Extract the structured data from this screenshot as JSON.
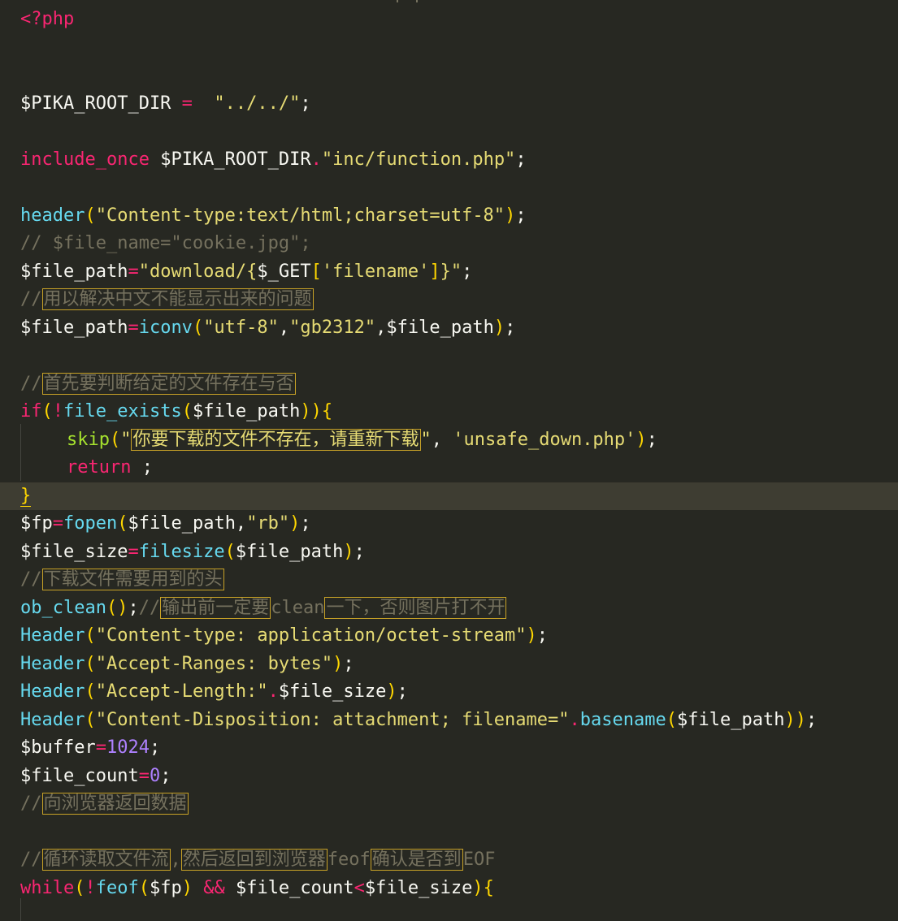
{
  "editor": {
    "lines": {
      "l01": {
        "t1": "<?php"
      },
      "l02": {
        "t1": "$PIKA_ROOT_DIR",
        "t2": " = ",
        "t3": " \"../../\"",
        "t4": ";"
      },
      "l03": {
        "t1": "include_once",
        "t2": " $PIKA_ROOT_DIR",
        "t3": ".",
        "t4": "\"inc/function.php\"",
        "t5": ";"
      },
      "l04": {
        "t1": "header",
        "t2": "(",
        "t3": "\"Content-type:text/html;charset=utf-8\"",
        "t4": ")",
        "t5": ";"
      },
      "l05": {
        "t1": "// $file_name=\"cookie.jpg\";"
      },
      "l06": {
        "t1": "$file_path",
        "t2": "=",
        "t3": "\"download/{",
        "t4": "$_GET",
        "t5": "[",
        "t6": "'filename'",
        "t7": "]",
        "t8": "}\"",
        "t9": ";"
      },
      "l07": {
        "t1": "//",
        "t2": "用以解决中文不能显示出来的问题"
      },
      "l08": {
        "t1": "$file_path",
        "t2": "=",
        "t3": "iconv",
        "t4": "(",
        "t5": "\"utf-8\"",
        "t6": ",",
        "t7": "\"gb2312\"",
        "t8": ",$file_path",
        "t9": ")",
        "t10": ";"
      },
      "l09": {
        "t1": "//",
        "t2": "首先要判断给定的文件存在与否"
      },
      "l10": {
        "t1": "if",
        "t2": "(",
        "t3": "!",
        "t4": "file_exists",
        "t5": "(",
        "t6": "$file_path",
        "t7": "))",
        "t8": "{"
      },
      "l11": {
        "t1": "skip",
        "t2": "(",
        "t3": "\"",
        "t4": "你要下载的文件不存在，请重新下载",
        "t5": "\"",
        "t6": ", ",
        "t7": "'unsafe_down.php'",
        "t8": ")",
        "t9": ";"
      },
      "l12": {
        "t1": "return",
        "t2": " ;"
      },
      "l13": {
        "t1": "}"
      },
      "l14": {
        "t1": "$fp",
        "t2": "=",
        "t3": "fopen",
        "t4": "(",
        "t5": "$file_path,",
        "t6": "\"rb\"",
        "t7": ")",
        "t8": ";"
      },
      "l15": {
        "t1": "$file_size",
        "t2": "=",
        "t3": "filesize",
        "t4": "(",
        "t5": "$file_path",
        "t6": ")",
        "t7": ";"
      },
      "l16": {
        "t1": "//",
        "t2": "下载文件需要用到的头"
      },
      "l17": {
        "t1": "ob_clean",
        "t2": "()",
        "t3": ";",
        "t4": "//",
        "t5": "输出前一定要",
        "t6": "clean",
        "t7": "一下，否则图片打不开"
      },
      "l18": {
        "t1": "Header",
        "t2": "(",
        "t3": "\"Content-type: application/octet-stream\"",
        "t4": ")",
        "t5": ";"
      },
      "l19": {
        "t1": "Header",
        "t2": "(",
        "t3": "\"Accept-Ranges: bytes\"",
        "t4": ")",
        "t5": ";"
      },
      "l20": {
        "t1": "Header",
        "t2": "(",
        "t3": "\"Accept-Length:\"",
        "t4": ".",
        "t5": "$file_size",
        "t6": ")",
        "t7": ";"
      },
      "l21": {
        "t1": "Header",
        "t2": "(",
        "t3": "\"Content-Disposition: attachment; filename=\"",
        "t4": ".",
        "t5": "basename",
        "t6": "(",
        "t7": "$file_path",
        "t8": "))",
        "t9": ";"
      },
      "l22": {
        "t1": "$buffer",
        "t2": "=",
        "t3": "1024",
        "t4": ";"
      },
      "l23": {
        "t1": "$file_count",
        "t2": "=",
        "t3": "0",
        "t4": ";"
      },
      "l24": {
        "t1": "//",
        "t2": "向浏览器返回数据"
      },
      "l25": {
        "t1": "//",
        "t2": "循环读取文件流",
        "t3": ",",
        "t4": "然后返回到浏览器",
        "t5": "feof",
        "t6": "确认是否到",
        "t7": "EOF"
      },
      "l26": {
        "t1": "while",
        "t2": "(",
        "t3": "!",
        "t4": "feof",
        "t5": "(",
        "t6": "$fp",
        "t7": ")",
        "t8": " && ",
        "t9": "$file_count",
        "t10": "<",
        "t11": "$file_size",
        "t12": ")",
        "t13": "{"
      }
    }
  },
  "colors": {
    "background": "#272822",
    "keyword": "#f92672",
    "function": "#66d9ef",
    "string": "#e6db74",
    "comment": "#75715e",
    "number": "#ae81ff",
    "bracket": "#ffd700",
    "current_line": "#3e3d32"
  }
}
